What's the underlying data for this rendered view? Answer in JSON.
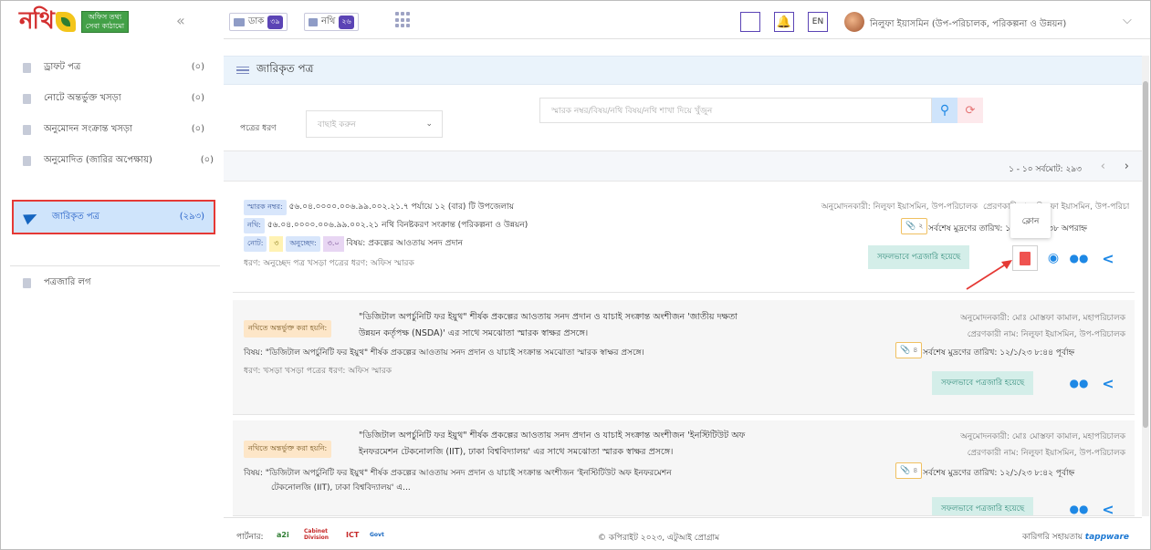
{
  "brand": {
    "name": "নথি",
    "subtitle_line1": "অফিস তথ্য",
    "subtitle_line2": "সেবা কাঠামো",
    "collapse": "«"
  },
  "topnav": {
    "dak_label": "ডাক",
    "dak_count": "৩৯",
    "nothi_label": "নথি",
    "nothi_count": "২৬",
    "lang": "EN",
    "user_name": "নিলুফা ইয়াসমিন (উপ-পরিচালক, পরিকল্পনা ও উন্নয়ন)",
    "chevron": "⌵"
  },
  "sidebar": {
    "items": [
      {
        "label": "ড্রাফট পত্র",
        "count": "(০)"
      },
      {
        "label": "নোটে অন্তর্ভুক্ত খসড়া",
        "count": "(০)"
      },
      {
        "label": "অনুমোদন সংক্রান্ত খসড়া",
        "count": "(০)"
      },
      {
        "label": "অনুমোদিত (জারির অপেক্ষায়)",
        "count": "(০)"
      },
      {
        "label": "জারিকৃত পত্র",
        "count": "(২৯৩)"
      },
      {
        "label": "পত্রজারি লগ",
        "count": ""
      }
    ]
  },
  "main": {
    "title": "জারিকৃত পত্র",
    "filter_label": "পত্রের ধরণ",
    "filter_placeholder": "বাছাই করুন",
    "search_placeholder": "স্মারক নম্বর/বিষয়/নথি বিষয়/নথি শাখা দিয়ে খুঁজুন",
    "pager_text": "১ - ১০ সর্বমোট: ২৯৩",
    "prev": "‹",
    "next": "›"
  },
  "cards": [
    {
      "memo_tag": "স্মারক নম্বর:",
      "memo": "৫৬.০৪.০০০০.০০৬.৯৯.০০২.২১.৭ পর্যায়ে ১২ (বার) টি উপজেলায়",
      "nothi_tag": "নথি:",
      "nothi": "৫৬.০৪.০০০০.০০৬.৯৯.০০২.২১ নথি বিনষ্টকরণ সংক্রান্ত (পরিকল্পনা ও উন্নয়ন)",
      "note_tag": "নোট:",
      "note_val": "৩",
      "para_tag": "অনুচ্ছেদ:",
      "para_val": "৩.০",
      "subject": "বিষয়: প্রকল্পের আওতায় সনদ প্রদান",
      "type_line": "ধরণ: অনুচ্ছেদ পত্র  খসড়া পত্রের ধরণ: অফিস স্মারক",
      "approver": "অনুমোদনকারী: নিলুফা ইয়াসমিন, উপ-পরিচালক",
      "sender": "প্রেরণকারী নাম: নিলুফা ইয়াসমিন, উপ-পরিচালক",
      "attach": "২",
      "print_date": "সর্বশেষ মুদ্রণের তারিখ: ১২/১/২৩ ১:৩৮ অপরাহ্ন",
      "status": "সফলভাবে পত্রজারি হয়েছে",
      "tooltip": "ক্লোন"
    },
    {
      "tag": "নথিতে অন্তর্ভুক্ত করা হয়নি:",
      "title_l1": "\"ডিজিটাল অপর্চুনিটি ফর ইয়ুথ\" শীর্ষক প্রকল্পের আওতায় সনদ প্রদান ও যাচাই সংক্রান্ত অংশীজন 'জাতীয় দক্ষতা",
      "title_l2": "উন্নয়ন কর্তৃপক্ষ (NSDA)' এর সাথে সমঝোতা স্মারক স্বাক্ষর প্রসঙ্গে।",
      "subject": "বিষয়: \"ডিজিটাল অপর্চুনিটি ফর ইয়ুথ\" শীর্ষক প্রকল্পের আওতায় সনদ প্রদান ও যাচাই সংক্রান্ত সমঝোতা স্মারক স্বাক্ষর প্রসঙ্গে।",
      "type_line": "ধরণ: খসড়া  খসড়া পত্রের ধরণ: অফিস স্মারক",
      "approver": "অনুমোদনকারী: মোঃ মোস্তফা কামাল, মহাপরিচালক",
      "sender": "প্রেরণকারী নাম: নিলুফা ইয়াসমিন, উপ-পরিচালক",
      "attach": "৪",
      "print_date": "সর্বশেষ মুদ্রণের তারিখ:  ১২/১/২৩ ৮:৪৪ পূর্বাহ্ন",
      "status": "সফলভাবে পত্রজারি হয়েছে"
    },
    {
      "tag": "নথিতে অন্তর্ভুক্ত করা হয়নি:",
      "title_l1": "\"ডিজিটাল অপর্চুনিটি ফর ইয়ুথ\" শীর্ষক প্রকল্পের আওতায় সনদ প্রদান ও যাচাই সংক্রান্ত অংশীজন 'ইনস্টিটিউট অফ",
      "title_l2": "ইনফরমেশন টেকনোলজি (IIT), ঢাকা বিশ্ববিদ্যালয়' এর সাথে সমঝোতা স্মারক স্বাক্ষর প্রসঙ্গে।",
      "subject_l1": "বিষয়: \"ডিজিটাল অপর্চুনিটি ফর ইয়ুথ\" শীর্ষক প্রকল্পের আওতায় সনদ প্রদান ও যাচাই সংক্রান্ত অংশীজন 'ইনস্টিটিউট অফ ইনফরমেশন",
      "subject_l2": "টেকনোলজি (IIT), ঢাকা বিশ্ববিদ্যালয়' এ...",
      "approver": "অনুমোদনকারী: মোঃ মোস্তফা কামাল, মহাপরিচালক",
      "sender": "প্রেরণকারী নাম: নিলুফা ইয়াসমিন, উপ-পরিচালক",
      "attach": "৪",
      "print_date": "সর্বশেষ মুদ্রণের তারিখ:  ১২/১/২৩ ৮:৪২ পূর্বাহ্ন",
      "status": "সফলভাবে পত্রজারি হয়েছে"
    }
  ],
  "footer": {
    "partner_label": "পার্টনার:",
    "partners": [
      "a2i",
      "Cabinet Division",
      "ICT",
      "Govt"
    ],
    "copyright": "© কপিরাইট ২০২৩, এটুআই প্রোগ্রাম",
    "tech_label": "কারিগরি সহায়তায়",
    "tech_brand": "tappware"
  },
  "colors": {
    "accent": "#5b44b5",
    "active_bg": "#cfe4fb",
    "highlight_border": "#e53935",
    "success_bg": "#d4eee9"
  },
  "icons": [
    "mail-icon",
    "folder-icon",
    "apps-grid-icon",
    "bell-icon",
    "hamburger-icon",
    "search-icon",
    "reset-icon",
    "paperclip-icon",
    "clone-icon",
    "eye-icon",
    "users-icon",
    "share-icon",
    "send-icon",
    "document-icon"
  ]
}
